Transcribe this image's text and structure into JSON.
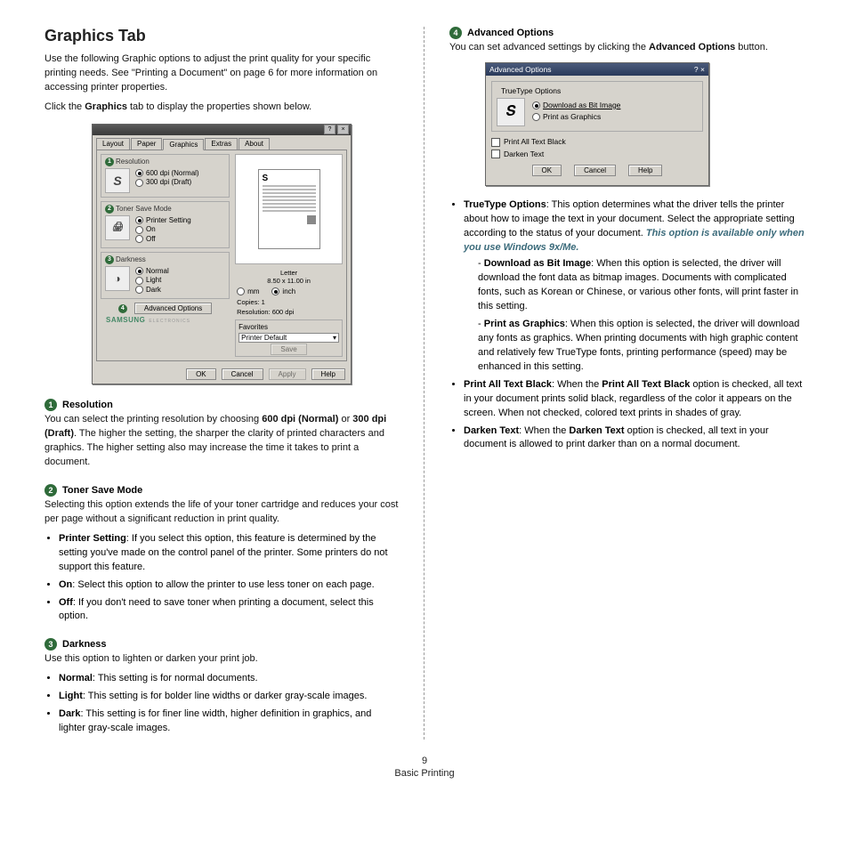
{
  "page": {
    "left": {
      "title": "Graphics Tab",
      "intro1_a": "Use the following Graphic options to adjust the print quality for your specific printing needs. See \"Printing a Document\" on page 6 for more information on accessing printer properties.",
      "intro2_a": "Click the ",
      "intro2_b": "Graphics",
      "intro2_c": " tab to display the properties shown below.",
      "sec1": {
        "num": "1",
        "head": "Resolution",
        "body_a": "You can select the printing resolution by choosing ",
        "body_b": "600 dpi (Normal)",
        "body_c": " or ",
        "body_d": "300 dpi (Draft)",
        "body_e": ". The higher the setting, the sharper the clarity of printed characters and graphics. The higher setting also may increase the time it takes to print a document."
      },
      "sec2": {
        "num": "2",
        "head": "Toner Save Mode",
        "intro": "Selecting this option extends the life of your toner cartridge and reduces your cost per page without a significant reduction in print quality.",
        "b1_a": "Printer Setting",
        "b1_b": ": If you select this option, this feature is determined by the setting you've made on the control panel of the printer. Some printers do not support this feature.",
        "b2_a": "On",
        "b2_b": ": Select this option to allow the printer to use less toner on each page.",
        "b3_a": "Off",
        "b3_b": ": If you don't need to save toner when printing a document, select this option."
      },
      "sec3": {
        "num": "3",
        "head": "Darkness",
        "intro": "Use this option to lighten or darken your print job.",
        "b1_a": "Normal",
        "b1_b": ": This setting is for normal documents.",
        "b2_a": "Light",
        "b2_b": ": This setting is for bolder line widths or darker gray-scale images.",
        "b3_a": "Dark",
        "b3_b": ": This setting is for finer line width, higher definition in graphics, and lighter gray-scale images."
      }
    },
    "right": {
      "sec4": {
        "num": "4",
        "head": "Advanced Options",
        "intro_a": "You can set advanced settings by clicking the ",
        "intro_b": "Advanced Options",
        "intro_c": " button."
      },
      "b1_a": "TrueType Options",
      "b1_b": ": This option determines what the driver tells the printer about how to image the text in your document. Select the appropriate setting according to the status of your document. ",
      "b1_c": "This option is available only when you use Windows 9x/Me.",
      "s1_a": "Download as Bit Image",
      "s1_b": ": When this option is selected, the driver will download the font data as bitmap images. Documents with complicated fonts, such as Korean or Chinese, or various other fonts, will print faster in this setting.",
      "s2_a": "Print as Graphics",
      "s2_b": ": When this option is selected, the driver will download any fonts as graphics. When printing documents with high graphic content and relatively few TrueType fonts, printing performance (speed) may be enhanced in this setting.",
      "b2_a": "Print All Text Black",
      "b2_b": ": When the ",
      "b2_c": "Print All Text Black",
      "b2_d": " option is checked, all text in your document prints solid black, regardless of the color it appears on the screen. When not checked, colored text prints in shades of gray.",
      "b3_a": "Darken Text",
      "b3_b": ": When the ",
      "b3_c": "Darken Text",
      "b3_d": " option is checked, all text in your document is allowed to print darker than on a normal document."
    },
    "footer": {
      "num": "9",
      "label": "Basic Printing"
    }
  },
  "shot1": {
    "tabs": {
      "layout": "Layout",
      "paper": "Paper",
      "graphics": "Graphics",
      "extras": "Extras",
      "about": "About"
    },
    "res": {
      "num": "1",
      "title": "Resolution",
      "o1": "600 dpi (Normal)",
      "o2": "300 dpi (Draft)",
      "icon": "S"
    },
    "toner": {
      "num": "2",
      "title": "Toner Save Mode",
      "o1": "Printer Setting",
      "o2": "On",
      "o3": "Off"
    },
    "dark": {
      "num": "3",
      "title": "Darkness",
      "o1": "Normal",
      "o2": "Light",
      "o3": "Dark"
    },
    "adv": {
      "num": "4",
      "btn": "Advanced Options"
    },
    "preview": {
      "s": "S",
      "label": "Letter",
      "size": "8.50 x 11.00 in",
      "mm": "mm",
      "inch": "inch",
      "copies_l": "Copies: 1",
      "res_l": "Resolution: 600 dpi"
    },
    "fav": {
      "title": "Favorites",
      "value": "Printer Default",
      "save": "Save"
    },
    "logo": "SAMSUNG",
    "logo_sub": "ELECTRONICS",
    "btns": {
      "ok": "OK",
      "cancel": "Cancel",
      "apply": "Apply",
      "help": "Help"
    }
  },
  "shot2": {
    "title": "Advanced Options",
    "group": "TrueType Options",
    "o1": "Download as Bit Image",
    "o2": "Print as Graphics",
    "c1": "Print All Text Black",
    "c2": "Darken Text",
    "ok": "OK",
    "cancel": "Cancel",
    "help": "Help"
  }
}
